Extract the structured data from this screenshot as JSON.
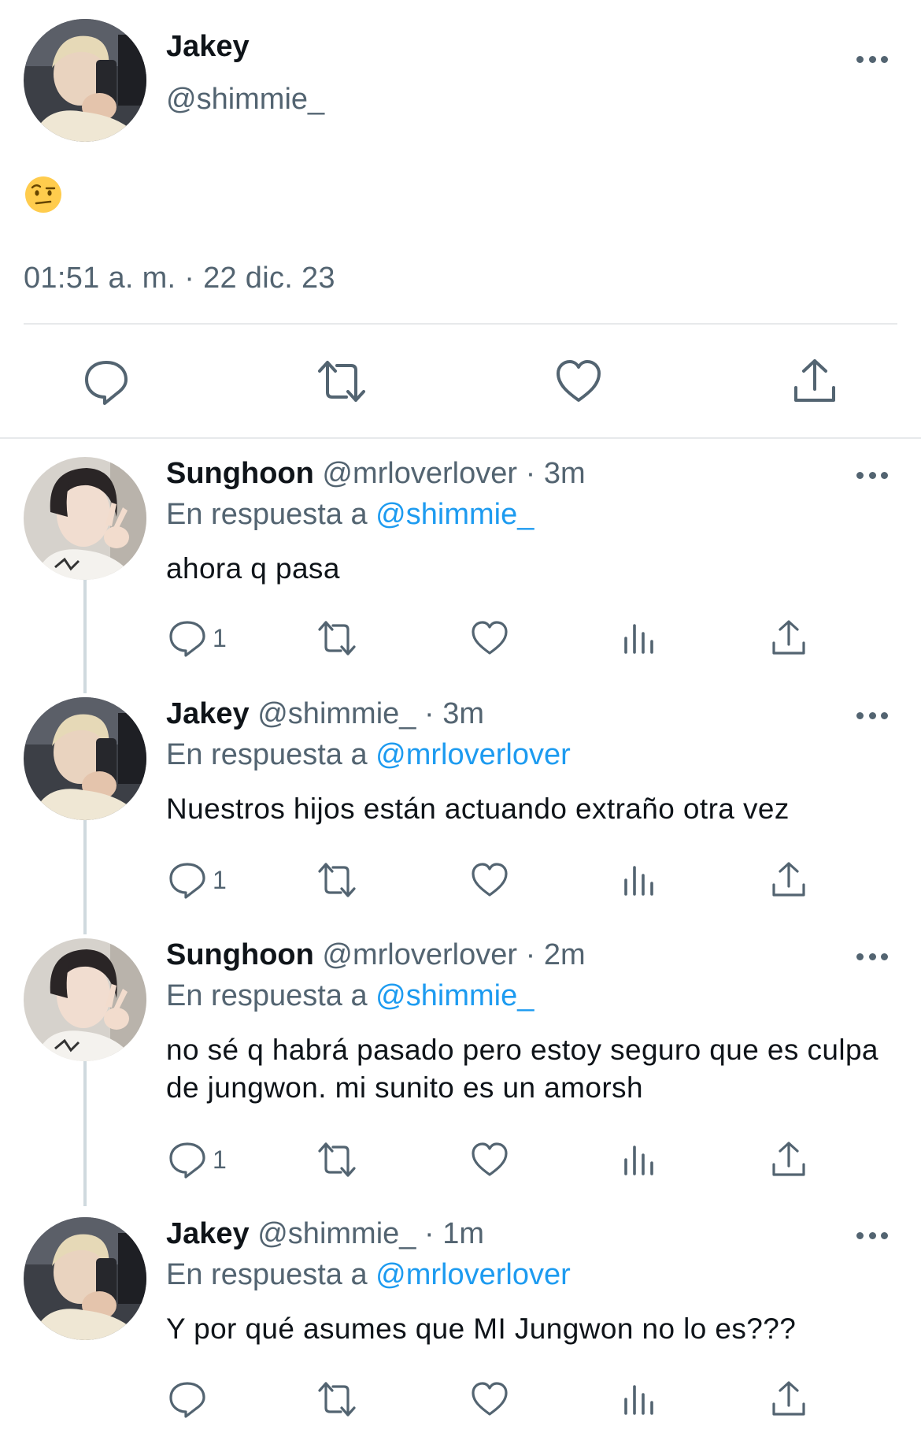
{
  "main": {
    "name": "Jakey",
    "handle": "@shimmie_",
    "emoji": "🤨",
    "timestamp": "01:51 a. m. · 22 dic. 23"
  },
  "replies": [
    {
      "name": "Sunghoon",
      "handle": "@mrloverlover",
      "time": "3m",
      "reply_label": "En respuesta a",
      "reply_to": "@shimmie_",
      "text": "ahora q pasa",
      "reply_count": "1",
      "avatar": "sunghoon"
    },
    {
      "name": "Jakey",
      "handle": "@shimmie_",
      "time": "3m",
      "reply_label": "En respuesta a",
      "reply_to": "@mrloverlover",
      "text": "Nuestros hijos están actuando extraño otra vez",
      "reply_count": "1",
      "avatar": "jakey"
    },
    {
      "name": "Sunghoon",
      "handle": "@mrloverlover",
      "time": "2m",
      "reply_label": "En respuesta a",
      "reply_to": "@shimmie_",
      "text": "no sé q habrá pasado pero estoy seguro que es culpa de jungwon. mi sunito es un amorsh",
      "reply_count": "1",
      "avatar": "sunghoon"
    },
    {
      "name": "Jakey",
      "handle": "@shimmie_",
      "time": "1m",
      "reply_label": "En respuesta a",
      "reply_to": "@mrloverlover",
      "text": "Y por qué asumes que MI Jungwon no lo es???",
      "reply_count": "",
      "avatar": "jakey"
    }
  ],
  "icons": {
    "more": "more-dots-icon",
    "reply": "reply-bubble-icon",
    "retweet": "retweet-icon",
    "like": "heart-icon",
    "views": "views-bar-icon",
    "share": "share-upload-icon"
  },
  "colors": {
    "text": "#0f1419",
    "secondary": "#536471",
    "link": "#1d9bf0",
    "divider": "#e7e9eb",
    "thread_line": "#cfd9de"
  }
}
